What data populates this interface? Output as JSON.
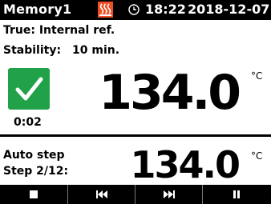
{
  "header": {
    "title": "Memory1",
    "heating_icon": "heating-icon",
    "clock_icon": "clock-icon",
    "time": "18:22",
    "date": "2018-12-07"
  },
  "info": {
    "line1": "True: Internal ref.",
    "stability_label": "Stability:",
    "stability_value": "10 min."
  },
  "status": {
    "icon": "checkmark-icon",
    "elapsed": "0:02",
    "color": "#21a148"
  },
  "main_temperature": {
    "value": "134.0",
    "unit": "°C"
  },
  "auto_step": {
    "label1": "Auto step",
    "label2": "Step 2/12:",
    "value": "134.0",
    "unit": "°C"
  },
  "controls": [
    {
      "icon": "stop-icon"
    },
    {
      "icon": "skip-back-icon"
    },
    {
      "icon": "skip-forward-icon"
    },
    {
      "icon": "pause-icon"
    }
  ],
  "colors": {
    "bar_bg": "#000000",
    "heater": "#f04e23",
    "check_bg": "#21a148"
  }
}
